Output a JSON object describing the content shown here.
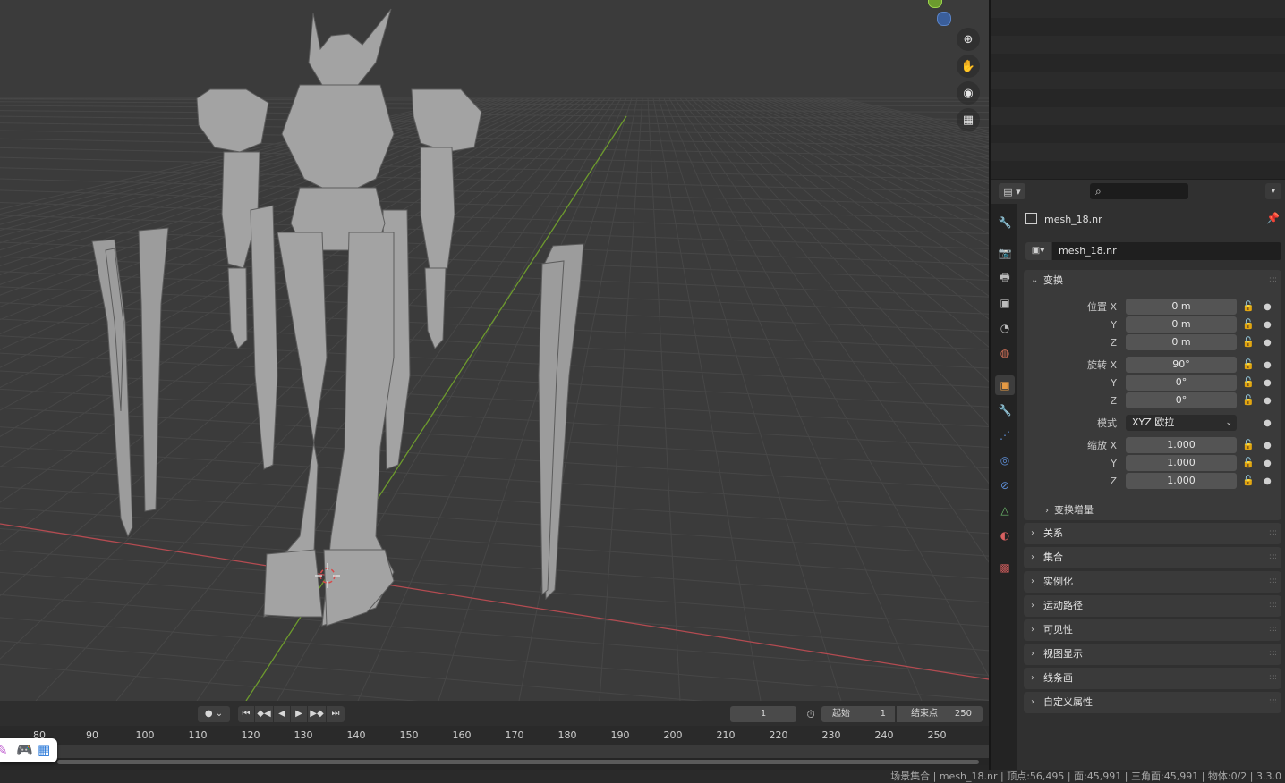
{
  "viewport": {
    "nav_icons": [
      "zoom-icon",
      "hand-pan-icon",
      "camera-icon",
      "grid-perspective-icon"
    ],
    "colors": {
      "x_axis": "#b44b51",
      "y_axis": "#6d9a2d",
      "grid": "#474747",
      "mesh": "#9a9a9a"
    }
  },
  "properties": {
    "search_placeholder": "⌕",
    "object_name": "mesh_18.nr",
    "object_field_value": "mesh_18.nr",
    "transform_panel": {
      "title": "变换",
      "location": {
        "label_x": "位置 X",
        "label_y": "Y",
        "label_z": "Z",
        "x": "0 m",
        "y": "0 m",
        "z": "0 m"
      },
      "rotation": {
        "label_x": "旋转 X",
        "label_y": "Y",
        "label_z": "Z",
        "x": "90°",
        "y": "0°",
        "z": "0°"
      },
      "mode": {
        "label": "模式",
        "value": "XYZ 欧拉"
      },
      "scale": {
        "label_x": "缩放 X",
        "label_y": "Y",
        "label_z": "Z",
        "x": "1.000",
        "y": "1.000",
        "z": "1.000"
      },
      "delta": "变换增量"
    },
    "panels": [
      "关系",
      "集合",
      "实例化",
      "运动路径",
      "可见性",
      "视图显示",
      "线条画",
      "自定义属性"
    ]
  },
  "timeline": {
    "current_frame": "1",
    "start_label": "起始",
    "start_value": "1",
    "end_label": "结束点",
    "end_value": "250",
    "ticks": [
      "80",
      "90",
      "100",
      "110",
      "120",
      "130",
      "140",
      "150",
      "160",
      "170",
      "180",
      "190",
      "200",
      "210",
      "220",
      "230",
      "240",
      "250"
    ]
  },
  "status": {
    "text": "场景集合 | mesh_18.nr | 顶点:56,495 | 面:45,991 | 三角面:45,991 | 物体:0/2 | 3.3.0"
  }
}
